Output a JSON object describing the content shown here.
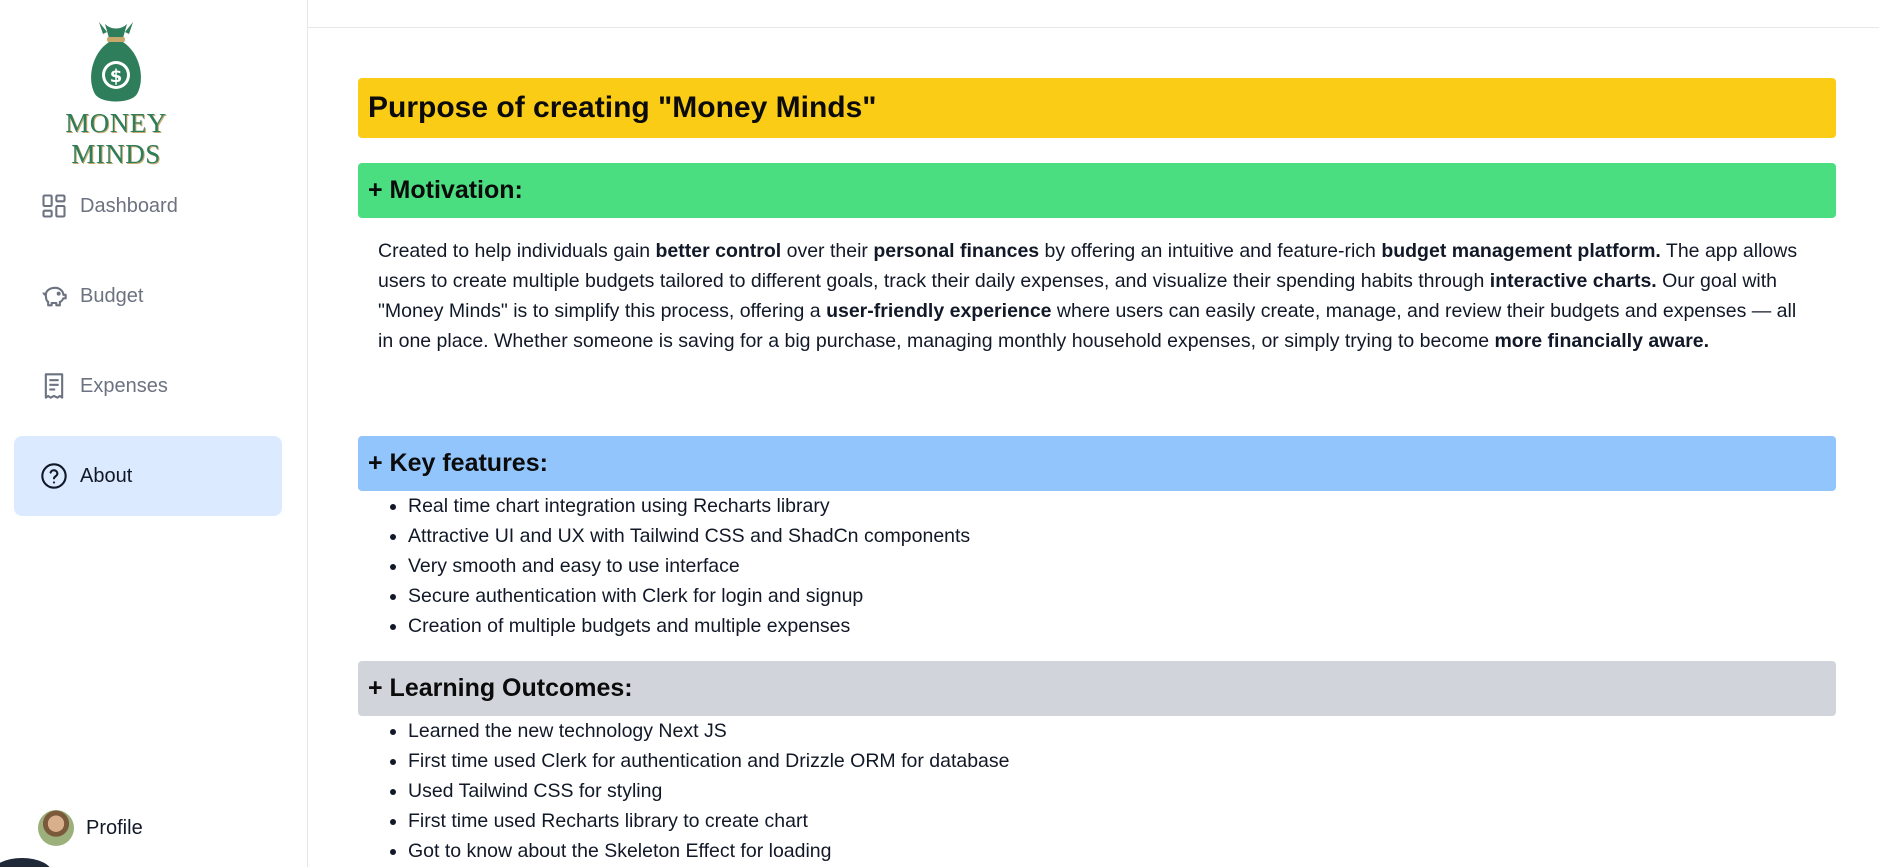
{
  "app": {
    "logo_text": "MONEY MINDS"
  },
  "sidebar": {
    "items": [
      {
        "label": "Dashboard",
        "icon": "grid-icon"
      },
      {
        "label": "Budget",
        "icon": "piggy-bank-icon"
      },
      {
        "label": "Expenses",
        "icon": "receipt-icon"
      },
      {
        "label": "About",
        "icon": "help-circle-icon",
        "active": true
      }
    ],
    "profile_label": "Profile"
  },
  "main": {
    "title": "Purpose of creating \"Money Minds\"",
    "motivation": {
      "heading": "+ Motivation:",
      "segments": [
        {
          "t": "Created to help individuals gain "
        },
        {
          "t": "better control",
          "b": true
        },
        {
          "t": " over their "
        },
        {
          "t": "personal finances",
          "b": true
        },
        {
          "t": " by offering an intuitive and feature-rich "
        },
        {
          "t": "budget management platform.",
          "b": true
        },
        {
          "t": " The app allows users to create multiple budgets tailored to different goals, track their daily expenses, and visualize their spending habits through "
        },
        {
          "t": "interactive charts.",
          "b": true
        },
        {
          "t": " Our goal with \"Money Minds\" is to simplify this process, offering a "
        },
        {
          "t": "user-friendly experience",
          "b": true
        },
        {
          "t": " where users can easily create, manage, and review their budgets and expenses — all in one place. Whether someone is saving for a big purchase, managing monthly household expenses, or simply trying to become "
        },
        {
          "t": "more financially aware.",
          "b": true
        }
      ]
    },
    "key_features": {
      "heading": "+ Key features:",
      "items": [
        "Real time chart integration using Recharts library",
        "Attractive UI and UX with Tailwind CSS and ShadCn components",
        "Very smooth and easy to use interface",
        "Secure authentication with Clerk for login and signup",
        "Creation of multiple budgets and multiple expenses"
      ]
    },
    "learning_outcomes": {
      "heading": "+ Learning Outcomes:",
      "items": [
        "Learned the new technology Next JS",
        "First time used Clerk for authentication and Drizzle ORM for database",
        "Used Tailwind CSS for styling",
        "First time used Recharts library to create chart",
        "Got to know about the Skeleton Effect for loading"
      ]
    }
  },
  "colors": {
    "title_bar": "#facc15",
    "motivation_bar": "#4ade80",
    "features_bar": "#93c5fd",
    "outcomes_bar": "#d1d5db",
    "active_nav_bg": "#dbeafe",
    "brand_green": "#2e7d5b"
  }
}
